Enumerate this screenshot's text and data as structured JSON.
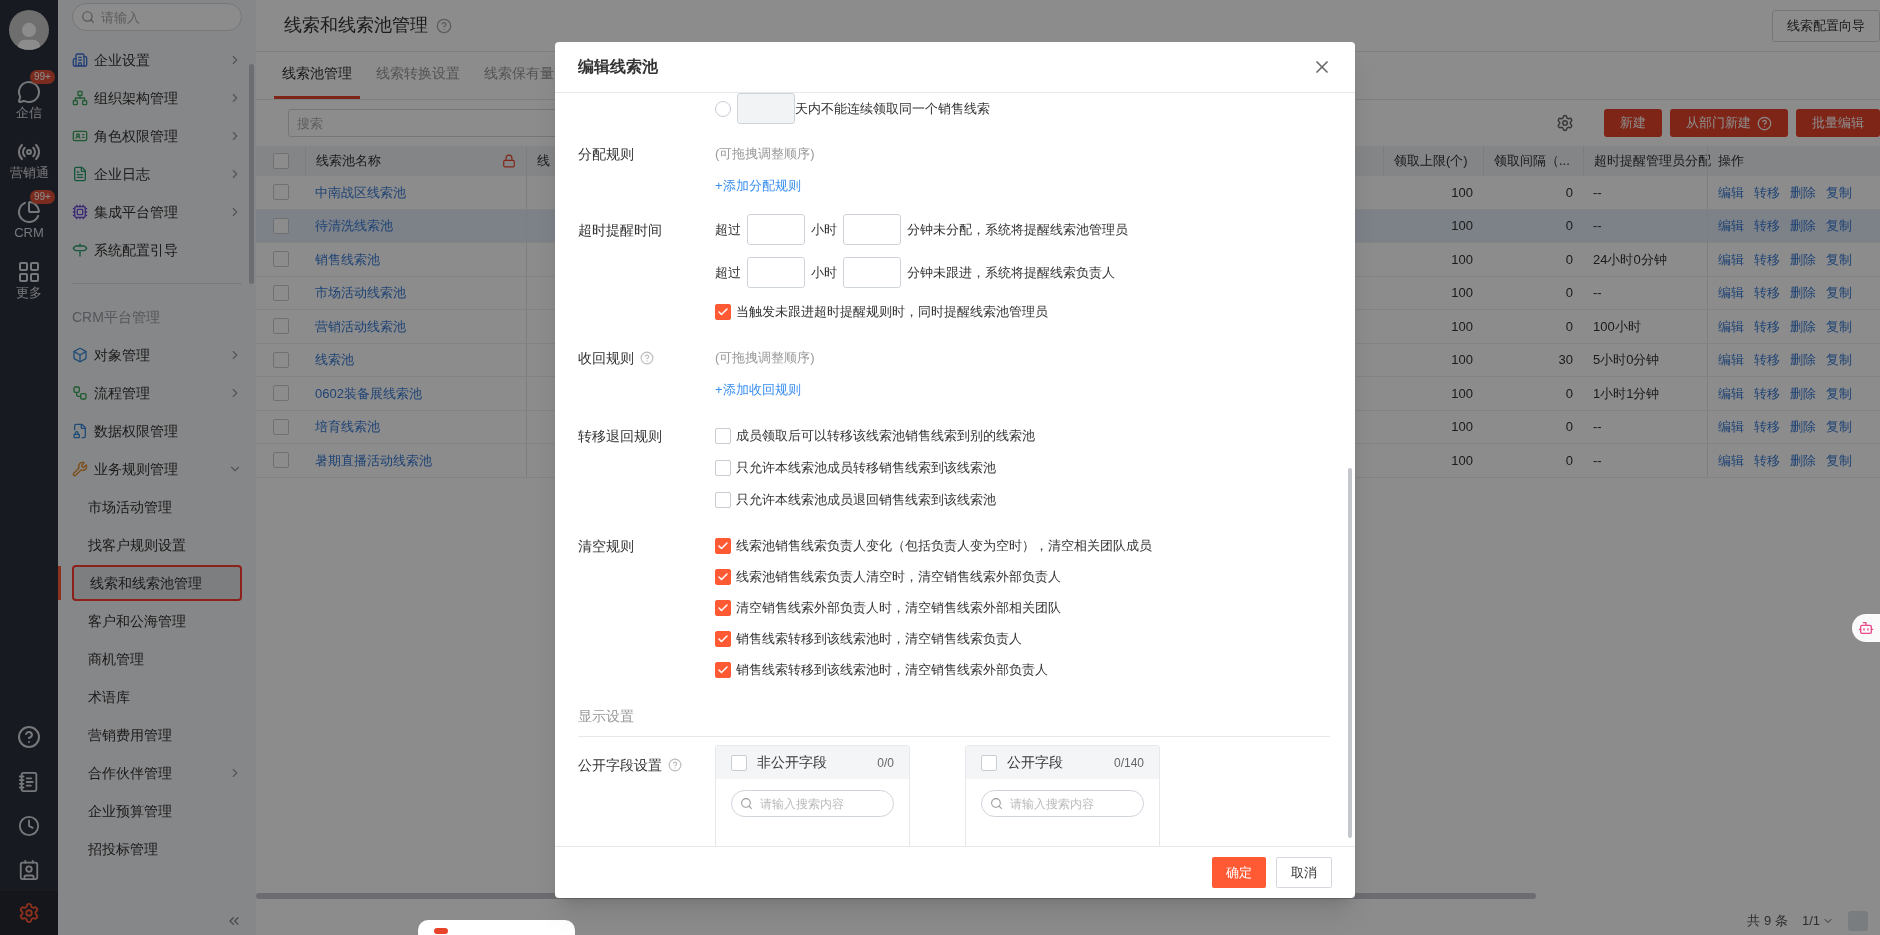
{
  "rail": {
    "items": [
      {
        "label": "企信",
        "badge": "99+"
      },
      {
        "label": "营销通"
      },
      {
        "label": "CRM",
        "badge": "99+"
      },
      {
        "label": "更多"
      }
    ]
  },
  "sidebar": {
    "search_placeholder": "请输入",
    "items": [
      {
        "kind": "item",
        "label": "企业设置",
        "expandable": true,
        "expanded": false
      },
      {
        "kind": "item",
        "label": "组织架构管理",
        "expandable": true,
        "expanded": false
      },
      {
        "kind": "item",
        "label": "角色权限管理",
        "expandable": true,
        "expanded": false
      },
      {
        "kind": "item",
        "label": "企业日志",
        "expandable": true,
        "expanded": false
      },
      {
        "kind": "item",
        "label": "集成平台管理",
        "expandable": true,
        "expanded": false
      },
      {
        "kind": "item",
        "label": "系统配置引导",
        "expandable": false,
        "expanded": false
      },
      {
        "kind": "section",
        "label": "CRM平台管理"
      },
      {
        "kind": "item",
        "label": "对象管理",
        "expandable": true,
        "expanded": false
      },
      {
        "kind": "item",
        "label": "流程管理",
        "expandable": true,
        "expanded": false
      },
      {
        "kind": "item",
        "label": "数据权限管理",
        "expandable": false,
        "expanded": false
      },
      {
        "kind": "item",
        "label": "业务规则管理",
        "expandable": true,
        "expanded": true,
        "children": [
          {
            "label": "市场活动管理",
            "expandable": false,
            "selected": false
          },
          {
            "label": "找客户规则设置",
            "expandable": false,
            "selected": false
          },
          {
            "label": "线索和线索池管理",
            "expandable": false,
            "selected": true
          },
          {
            "label": "客户和公海管理",
            "expandable": false,
            "selected": false
          },
          {
            "label": "商机管理",
            "expandable": false,
            "selected": false
          },
          {
            "label": "术语库",
            "expandable": false,
            "selected": false
          },
          {
            "label": "营销费用管理",
            "expandable": false,
            "selected": false
          },
          {
            "label": "合作伙伴管理",
            "expandable": true,
            "selected": false
          },
          {
            "label": "企业预算管理",
            "expandable": false,
            "selected": false
          },
          {
            "label": "招投标管理",
            "expandable": false,
            "selected": false
          }
        ]
      }
    ]
  },
  "header": {
    "title": "线索和线索池管理",
    "wizard_button": "线索配置向导"
  },
  "tabs": [
    {
      "label": "线索池管理",
      "selected": true
    },
    {
      "label": "线索转换设置",
      "selected": false
    },
    {
      "label": "线索保有量",
      "selected": false
    }
  ],
  "toolbar": {
    "search_placeholder": "搜索",
    "buttons": [
      {
        "label": "新建",
        "help": false
      },
      {
        "label": "从部门新建",
        "help": true
      },
      {
        "label": "批量编辑",
        "help": false
      }
    ]
  },
  "table": {
    "select_all_checked": false,
    "columns": [
      "线索池名称",
      "线",
      "领取上限(个)",
      "领取间隔（...",
      "超时提醒管理员分配",
      "操作"
    ],
    "rows": [
      {
        "checked": false,
        "selected": false,
        "name": "中南战区线索池",
        "limit": "100",
        "interval": "0",
        "timeout": "--",
        "actions": [
          "编辑",
          "转移",
          "删除",
          "复制"
        ]
      },
      {
        "checked": false,
        "selected": true,
        "name": "待清洗线索池",
        "limit": "100",
        "interval": "0",
        "timeout": "--",
        "actions": [
          "编辑",
          "转移",
          "删除",
          "复制"
        ]
      },
      {
        "checked": false,
        "selected": false,
        "name": "销售线索池",
        "limit": "100",
        "interval": "0",
        "timeout": "24小时0分钟",
        "actions": [
          "编辑",
          "转移",
          "删除",
          "复制"
        ]
      },
      {
        "checked": false,
        "selected": false,
        "name": "市场活动线索池",
        "limit": "100",
        "interval": "0",
        "timeout": "--",
        "actions": [
          "编辑",
          "转移",
          "删除",
          "复制"
        ]
      },
      {
        "checked": false,
        "selected": false,
        "name": "营销活动线索池",
        "limit": "100",
        "interval": "0",
        "timeout": "100小时",
        "actions": [
          "编辑",
          "转移",
          "删除",
          "复制"
        ]
      },
      {
        "checked": false,
        "selected": false,
        "name": "线索池",
        "limit": "100",
        "interval": "30",
        "timeout": "5小时0分钟",
        "actions": [
          "编辑",
          "转移",
          "删除",
          "复制"
        ]
      },
      {
        "checked": false,
        "selected": false,
        "name": "0602装备展线索池",
        "limit": "100",
        "interval": "0",
        "timeout": "1小时1分钟",
        "actions": [
          "编辑",
          "转移",
          "删除",
          "复制"
        ]
      },
      {
        "checked": false,
        "selected": false,
        "name": "培育线索池",
        "limit": "100",
        "interval": "0",
        "timeout": "--",
        "actions": [
          "编辑",
          "转移",
          "删除",
          "复制"
        ]
      },
      {
        "checked": false,
        "selected": false,
        "name": "暑期直播活动线索池",
        "limit": "100",
        "interval": "0",
        "timeout": "--",
        "actions": [
          "编辑",
          "转移",
          "删除",
          "复制"
        ]
      }
    ]
  },
  "pagination": {
    "total": "共 9 条",
    "page": "1/1"
  },
  "dialog": {
    "title": "编辑线索池",
    "interval_rule": {
      "checked": false,
      "text": "天内不能连续领取同一个销售线索"
    },
    "assign": {
      "label": "分配规则",
      "hint": "(可拖拽调整顺序)",
      "link": "+添加分配规则"
    },
    "timeout": {
      "label": "超时提醒时间",
      "rows": [
        {
          "prefix": "超过",
          "hours_unit": "小时",
          "suffix": "分钟未分配，系统将提醒线索池管理员"
        },
        {
          "prefix": "超过",
          "hours_unit": "小时",
          "suffix": "分钟未跟进，系统将提醒线索负责人"
        }
      ],
      "notify": {
        "checked": true,
        "text": "当触发未跟进超时提醒规则时，同时提醒线索池管理员"
      }
    },
    "recall": {
      "label": "收回规则",
      "hint": "(可拖拽调整顺序)",
      "link": "+添加收回规则"
    },
    "transfer": {
      "label": "转移退回规则",
      "options": [
        {
          "checked": false,
          "text": "成员领取后可以转移该线索池销售线索到别的线索池"
        },
        {
          "checked": false,
          "text": "只允许本线索池成员转移销售线索到该线索池"
        },
        {
          "checked": false,
          "text": "只允许本线索池成员退回销售线索到该线索池"
        }
      ]
    },
    "clear": {
      "label": "清空规则",
      "options": [
        {
          "checked": true,
          "text": "线索池销售线索负责人变化（包括负责人变为空时），清空相关团队成员"
        },
        {
          "checked": true,
          "text": "线索池销售线索负责人清空时，清空销售线索外部负责人"
        },
        {
          "checked": true,
          "text": "清空销售线索外部负责人时，清空销售线索外部相关团队"
        },
        {
          "checked": true,
          "text": "销售线索转移到该线索池时，清空销售线索负责人"
        },
        {
          "checked": true,
          "text": "销售线索转移到该线索池时，清空销售线索外部负责人"
        }
      ]
    },
    "display_section": "显示设置",
    "fields": {
      "label": "公开字段设置",
      "panels": [
        {
          "checked": false,
          "title": "非公开字段",
          "count": "0/0",
          "search_placeholder": "请输入搜索内容"
        },
        {
          "checked": false,
          "title": "公开字段",
          "count": "0/140",
          "search_placeholder": "请输入搜索内容"
        }
      ]
    },
    "ok": "确定",
    "cancel": "取消"
  }
}
